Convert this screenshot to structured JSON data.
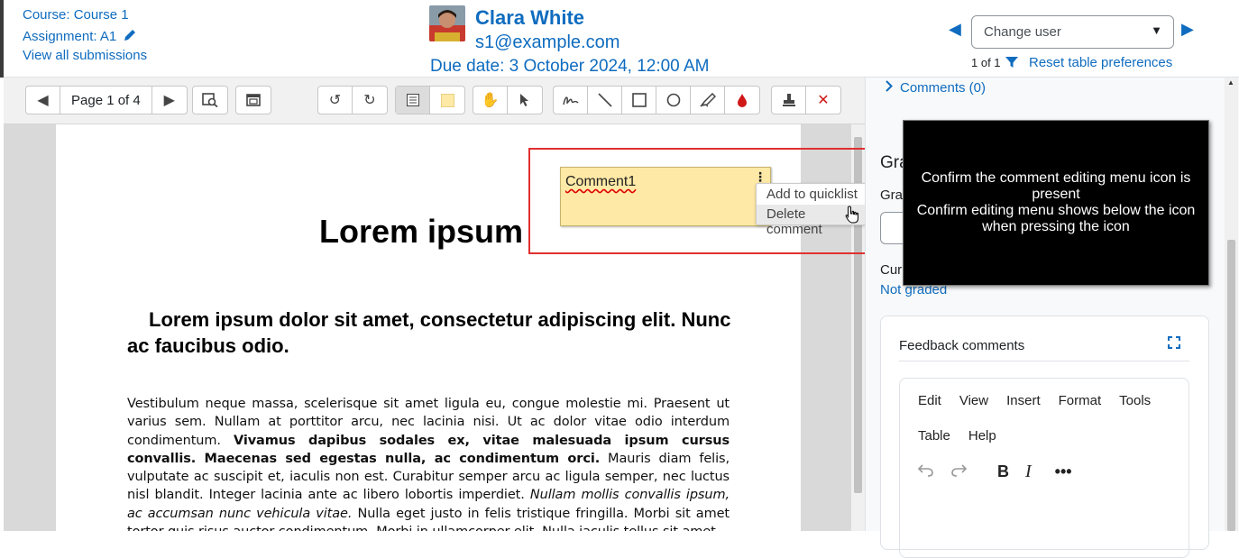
{
  "header": {
    "course_link": "Course: Course 1",
    "assignment_link": "Assignment: A1",
    "view_all": "View all submissions",
    "user_name": "Clara White",
    "user_email": "s1@example.com",
    "due_date": "Due date: 3 October 2024, 12:00 AM",
    "change_user_placeholder": "Change user",
    "paging": "1 of 1",
    "reset_link": "Reset table preferences"
  },
  "toolbar": {
    "page_label": "Page 1 of 4"
  },
  "document": {
    "title": "Lorem ipsum",
    "heading": "Lorem ipsum dolor sit amet, consectetur adipiscing elit. Nunc ac faucibus odio.",
    "body_1": "Vestibulum neque massa, scelerisque sit amet ligula eu, congue molestie mi. Praesent ut varius sem. Nullam at porttitor arcu, nec lacinia nisi. Ut ac dolor vitae odio interdum condimentum. ",
    "body_bold": "Vivamus dapibus sodales ex, vitae malesuada ipsum cursus convallis. Maecenas sed egestas nulla, ac condimentum orci.",
    "body_2": " Mauris diam felis, vulputate ac suscipit et, iaculis non est. Curabitur semper arcu ac ligula semper, nec luctus nisl blandit. Integer lacinia ante ac libero lobortis imperdiet. ",
    "body_italic": "Nullam mollis convallis ipsum, ac accumsan nunc vehicula vitae.",
    "body_3": " Nulla eget justo in felis tristique fringilla. Morbi sit amet tortor quis risus auctor condimentum. Morbi in ullamcorper elit. Nulla iaculis tellus sit amet"
  },
  "comment": {
    "text": "Comment1",
    "menu_items": [
      "Add to quicklist",
      "Delete comment"
    ]
  },
  "right_panel": {
    "comments_link": "Comments (0)",
    "grade_heading_partial": "Gra",
    "grade_label_partial": "Gra",
    "current_grade_partial": "Cur",
    "not_graded": "Not graded",
    "feedback_title": "Feedback comments",
    "editor_menu_row1": [
      "Edit",
      "View",
      "Insert",
      "Format",
      "Tools"
    ],
    "editor_menu_row2": [
      "Table",
      "Help"
    ]
  },
  "note": {
    "line1": "Confirm the comment editing menu icon is present",
    "line2": "Confirm editing menu shows below the icon when pressing the icon"
  },
  "colors": {
    "link": "#0f6cbf",
    "comment_bg": "#ffe9a6",
    "highlight_border": "#e03030"
  }
}
